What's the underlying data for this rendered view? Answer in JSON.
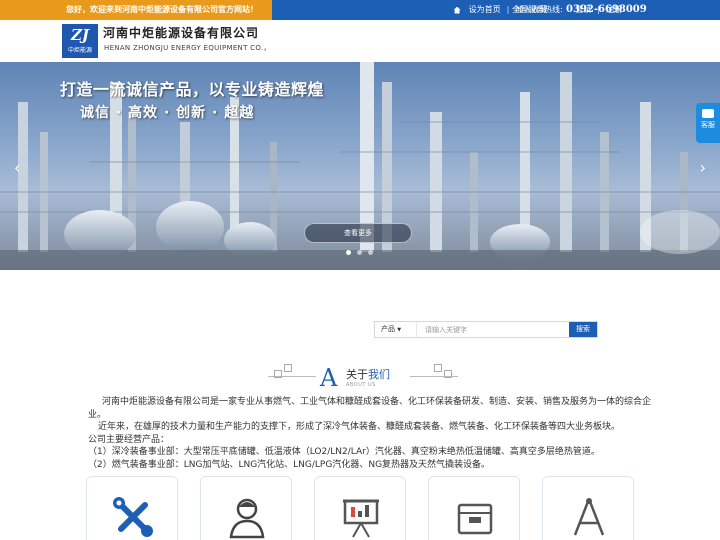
{
  "topbar": {
    "welcome": "您好，欢迎来到河南中炬能源设备有限公司官方网站！",
    "home_link": "设为首页",
    "favorite_link": "加入收藏",
    "login": "登录",
    "register": "注册",
    "hotline_label": "全国服务热线:",
    "hotline": "0392-6698009"
  },
  "header": {
    "logo_mark": "ZJ",
    "logo_subtext": "中炬能源",
    "company_cn": "河南中炬能源设备有限公司",
    "company_en": "HENAN ZHONGJU ENERGY EQUIPMENT CO.，"
  },
  "hero": {
    "headline": "打造一流诚信产品，以专业铸造辉煌",
    "subline": "诚信 · 高效 · 创新 · 超越",
    "more_button": "查看更多",
    "prev_icon": "chevron-left-icon",
    "next_icon": "chevron-right-icon",
    "active_slide": 1,
    "slide_count": 3
  },
  "side_service": {
    "label": "客服"
  },
  "search": {
    "category": "产品",
    "placeholder": "请输入关键字",
    "button": "搜索"
  },
  "about": {
    "letter": "A",
    "title_prefix": "关于",
    "title_highlight": "我们",
    "subtitle": "ABOUT US",
    "paragraphs": [
      "河南中炬能源设备有限公司是一家专业从事燃气、工业气体和糠醛成套设备、化工环保装备研发、制造、安装、销售及服务为一体的综合企业。",
      "近年来，在雄厚的技术力量和生产能力的支撑下，形成了深冷气体装备、糠醛成套装备、燃气装备、化工环保装备等四大业务板块。",
      "公司主要经营产品：",
      "（1）深冷装备事业部：大型常压平底储罐、低温液体（LO2/LN2/LAr）汽化器、真空粉末绝热低温储罐、高真空多层绝热管道。",
      "（2）燃气装备事业部：LNG加气站、LNG汽化站、LNG/LPG汽化器、NG复热器及天然气撬装设备。"
    ]
  },
  "services": {
    "cards": [
      {
        "icon": "tools-icon"
      },
      {
        "icon": "engineer-icon"
      },
      {
        "icon": "presentation-icon"
      },
      {
        "icon": "box-icon"
      },
      {
        "icon": "compass-icon"
      }
    ]
  },
  "colors": {
    "brand_blue": "#1d5fb4",
    "welcome_orange": "#e99a1a"
  }
}
